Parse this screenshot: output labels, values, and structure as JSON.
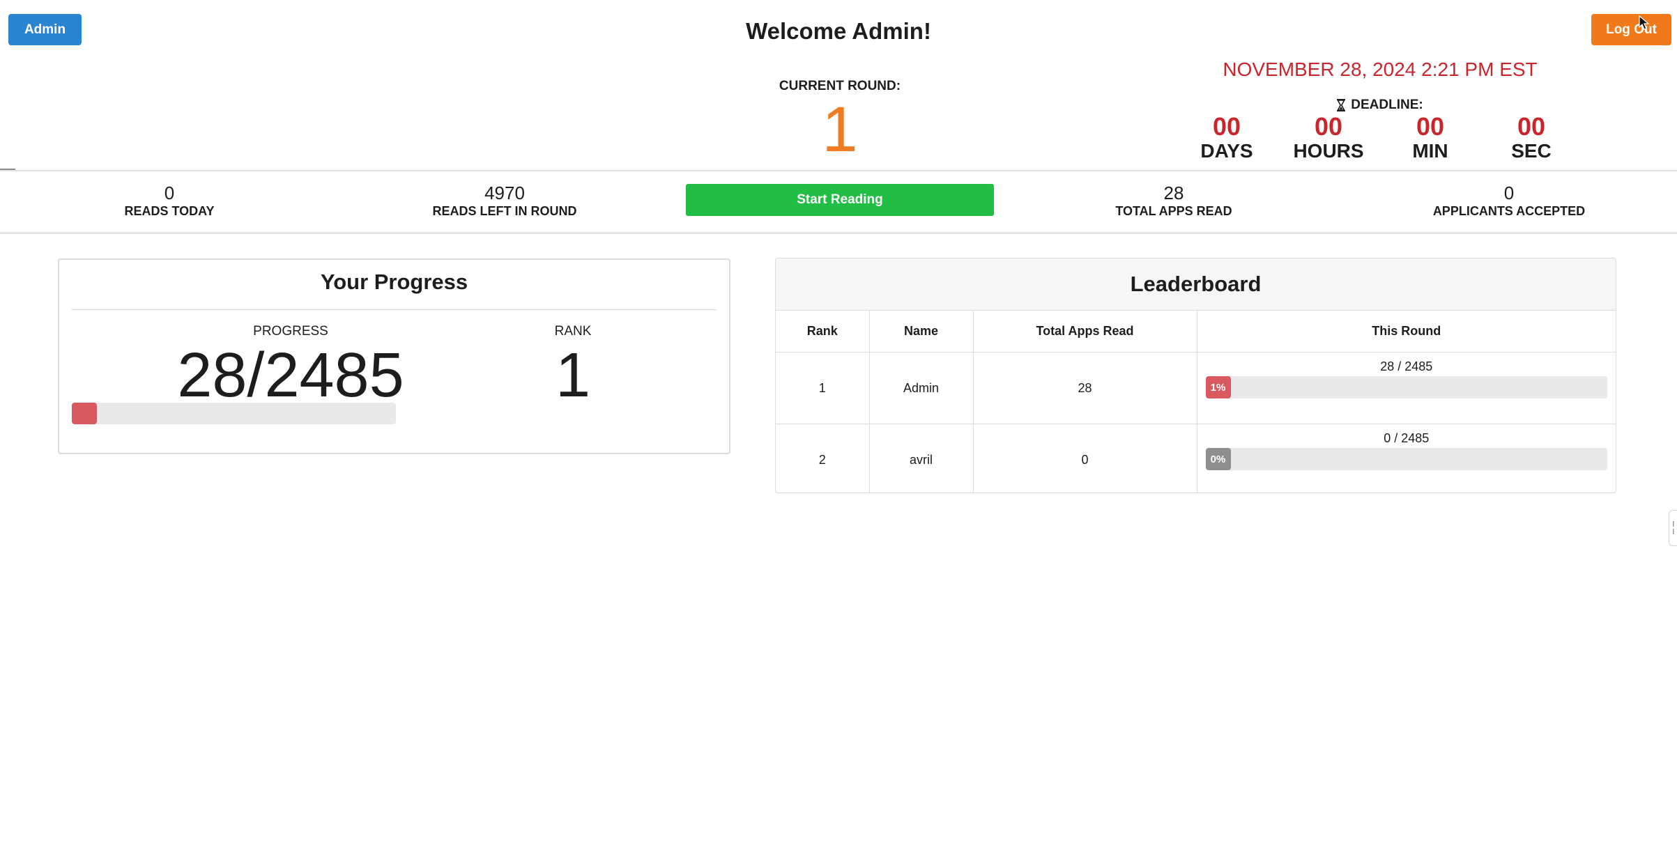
{
  "header": {
    "admin_label": "Admin",
    "welcome": "Welcome Admin!",
    "logout_label": "Log Out",
    "current_round_label": "CURRENT ROUND:",
    "current_round": "1",
    "datetime": "NOVEMBER 28, 2024 2:21 PM EST",
    "deadline_label": "DEADLINE:",
    "countdown": [
      {
        "value": "00",
        "unit": "DAYS"
      },
      {
        "value": "00",
        "unit": "HOURS"
      },
      {
        "value": "00",
        "unit": "MIN"
      },
      {
        "value": "00",
        "unit": "SEC"
      }
    ]
  },
  "stats": {
    "reads_today": {
      "value": "0",
      "label": "READS TODAY"
    },
    "reads_left": {
      "value": "4970",
      "label": "READS LEFT IN ROUND"
    },
    "start_reading_label": "Start Reading",
    "total_apps_read": {
      "value": "28",
      "label": "TOTAL APPS READ"
    },
    "applicants_accepted": {
      "value": "0",
      "label": "APPLICANTS ACCEPTED"
    }
  },
  "progress": {
    "title": "Your Progress",
    "progress_label": "PROGRESS",
    "progress_value": "28/2485",
    "progress_fraction": 0.0113,
    "rank_label": "RANK",
    "rank_value": "1"
  },
  "leaderboard": {
    "title": "Leaderboard",
    "columns": [
      "Rank",
      "Name",
      "Total Apps Read",
      "This Round"
    ],
    "rows": [
      {
        "rank": "1",
        "name": "Admin",
        "total": "28",
        "round_text": "28 / 2485",
        "percent_label": "1%",
        "percent": 1.13
      },
      {
        "rank": "2",
        "name": "avril",
        "total": "0",
        "round_text": "0 / 2485",
        "percent_label": "0%",
        "percent": 0
      }
    ]
  },
  "colors": {
    "primary_blue": "#2a84d2",
    "logout_orange": "#f07a1a",
    "round_orange": "#ef7b22",
    "deadline_red": "#c8262c",
    "start_green": "#22bd45",
    "progress_red": "#d95a5e",
    "zero_gray": "#8e8e8e"
  }
}
